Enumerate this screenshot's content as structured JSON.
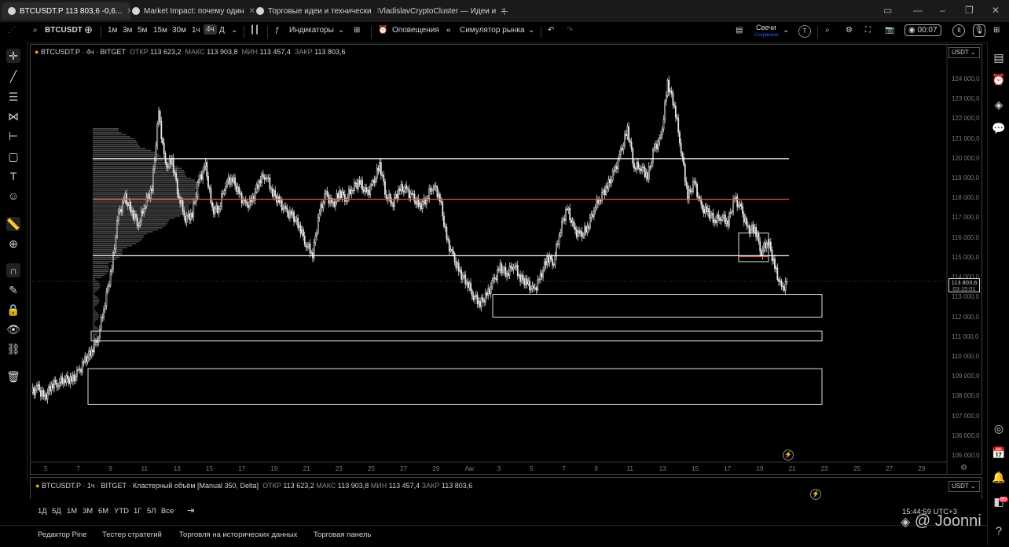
{
  "tabs": [
    {
      "label": "BTCUSDT.P 113 803,6 -0,6...",
      "active": true
    },
    {
      "label": "Market Impact: почему один"
    },
    {
      "label": "Торговые идеи и технически"
    },
    {
      "label": "VladislavCryptoCluster — Идеи и"
    }
  ],
  "toolbar": {
    "symbol": "BTCUSDT",
    "intervals": [
      "1м",
      "3м",
      "5м",
      "15м",
      "30м",
      "1ч",
      "4ч",
      "Д"
    ],
    "selected_interval": "4ч",
    "indicators": "Индикаторы",
    "alerts": "Оповещения",
    "replay": "Симулятор рынка",
    "candles": "Свечи",
    "candles_sub": "Сохранено",
    "record_time": "00:07",
    "t_badge": "T"
  },
  "chart": {
    "legend_symbol": "BTCUSDT.P · 4ч · BITGET",
    "open_label": "ОТКР",
    "open": "113 623,2",
    "high_label": "МАКС",
    "high": "113 903,8",
    "low_label": "МИН",
    "low": "113 457,4",
    "close_label": "ЗАКР",
    "close": "113 803,6",
    "currency": "USDT",
    "last_price": "113 803,6",
    "countdown": "03:15:01",
    "y_ticks": [
      "124 000,0",
      "123 000,0",
      "122 000,0",
      "121 000,0",
      "120 000,0",
      "119 000,0",
      "118 000,0",
      "117 000,0",
      "116 000,0",
      "115 000,0",
      "114 000,0",
      "113 000,0",
      "112 000,0",
      "111 000,0",
      "110 000,0",
      "109 000,0",
      "108 000,0",
      "107 000,0",
      "106 000,0",
      "105 000,0"
    ],
    "x_ticks": [
      "5",
      "7",
      "9",
      "11",
      "13",
      "15",
      "17",
      "19",
      "21",
      "23",
      "25",
      "27",
      "29",
      "Авг",
      "3",
      "5",
      "7",
      "9",
      "11",
      "13",
      "15",
      "17",
      "19",
      "21",
      "23",
      "25",
      "27",
      "29"
    ]
  },
  "chart_data": {
    "type": "candlestick",
    "y_range": [
      104600,
      124500
    ],
    "levels": [
      {
        "price": 120000,
        "color": "#ffffff"
      },
      {
        "price": 117950,
        "color": "#e05555"
      },
      {
        "price": 115100,
        "color": "#ffffff"
      }
    ],
    "zones": [
      {
        "from": 112000,
        "to": 113150
      },
      {
        "from": 110800,
        "to": 111300
      },
      {
        "from": 107600,
        "to": 109400
      }
    ],
    "close_path": [
      108200,
      108400,
      107900,
      108600,
      108700,
      108900,
      108800,
      109200,
      109800,
      110300,
      111100,
      112800,
      114500,
      117200,
      118000,
      117300,
      116700,
      117800,
      118500,
      122300,
      119600,
      119900,
      118100,
      117000,
      117200,
      118900,
      119600,
      117400,
      117500,
      118800,
      119000,
      118200,
      117600,
      117900,
      118900,
      119200,
      118300,
      117800,
      117300,
      117100,
      116600,
      115700,
      115200,
      117300,
      118200,
      117600,
      118300,
      118000,
      118600,
      118800,
      118200,
      118700,
      119700,
      118100,
      117800,
      118500,
      118400,
      118000,
      117600,
      118000,
      118700,
      118000,
      115900,
      115000,
      114200,
      113800,
      113100,
      112700,
      113100,
      113800,
      114500,
      114200,
      114700,
      114000,
      113700,
      113300,
      114000,
      115000,
      114800,
      116500,
      117500,
      116400,
      116100,
      116500,
      117500,
      118100,
      118600,
      119300,
      120300,
      121500,
      119600,
      119600,
      119100,
      120500,
      121000,
      123800,
      122700,
      120500,
      118100,
      118800,
      117500,
      117300,
      116900,
      117100,
      116800,
      118000,
      117400,
      116400,
      116500,
      115300,
      115900,
      114500,
      113400,
      113800
    ]
  },
  "pane2": {
    "legend": "BTCUSDT.P · 1ч · BITGET · Кластерный объём [Manual 350, Delta]",
    "open": "113 623,2",
    "high": "113 903,8",
    "low": "113 457,4",
    "close": "113 803,6",
    "currency": "USDT"
  },
  "range_buttons": [
    "1Д",
    "5Д",
    "1М",
    "3М",
    "6М",
    "YTD",
    "1Г",
    "5Л",
    "Все"
  ],
  "clock": "15:44:59 UTC+3",
  "bottom_tabs": [
    "Редактор Pine",
    "Тестер стратегий",
    "Торговля на исторических данных",
    "Торговая панель"
  ],
  "watermark": "@ Joonni",
  "notif_count": "80"
}
